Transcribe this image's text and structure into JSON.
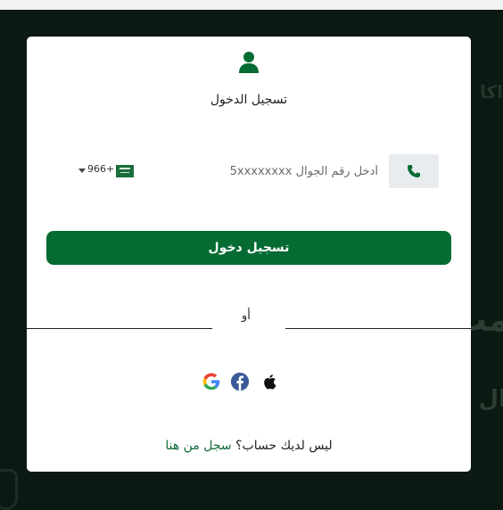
{
  "background": {
    "text_1": "اكا",
    "text_2": "مب",
    "text_3": "ال"
  },
  "modal": {
    "title": "تسجيل الدخول",
    "phone": {
      "placeholder": "أدخل رقم الجوال 5xxxxxxxx",
      "country_code": "966+"
    },
    "login_button": "تسجيل دخول",
    "or_text": "أو",
    "signup": {
      "prompt": "ليس لديك حساب؟",
      "link": "سجل من هنا"
    }
  },
  "icons": {
    "user": "user-icon",
    "phone": "phone-icon",
    "flag": "saudi-flag-icon",
    "google": "google-icon",
    "facebook": "facebook-icon",
    "apple": "apple-icon"
  },
  "colors": {
    "brand_green": "#046c33",
    "link_green": "#0f6b3a",
    "background": "#0c1812"
  }
}
